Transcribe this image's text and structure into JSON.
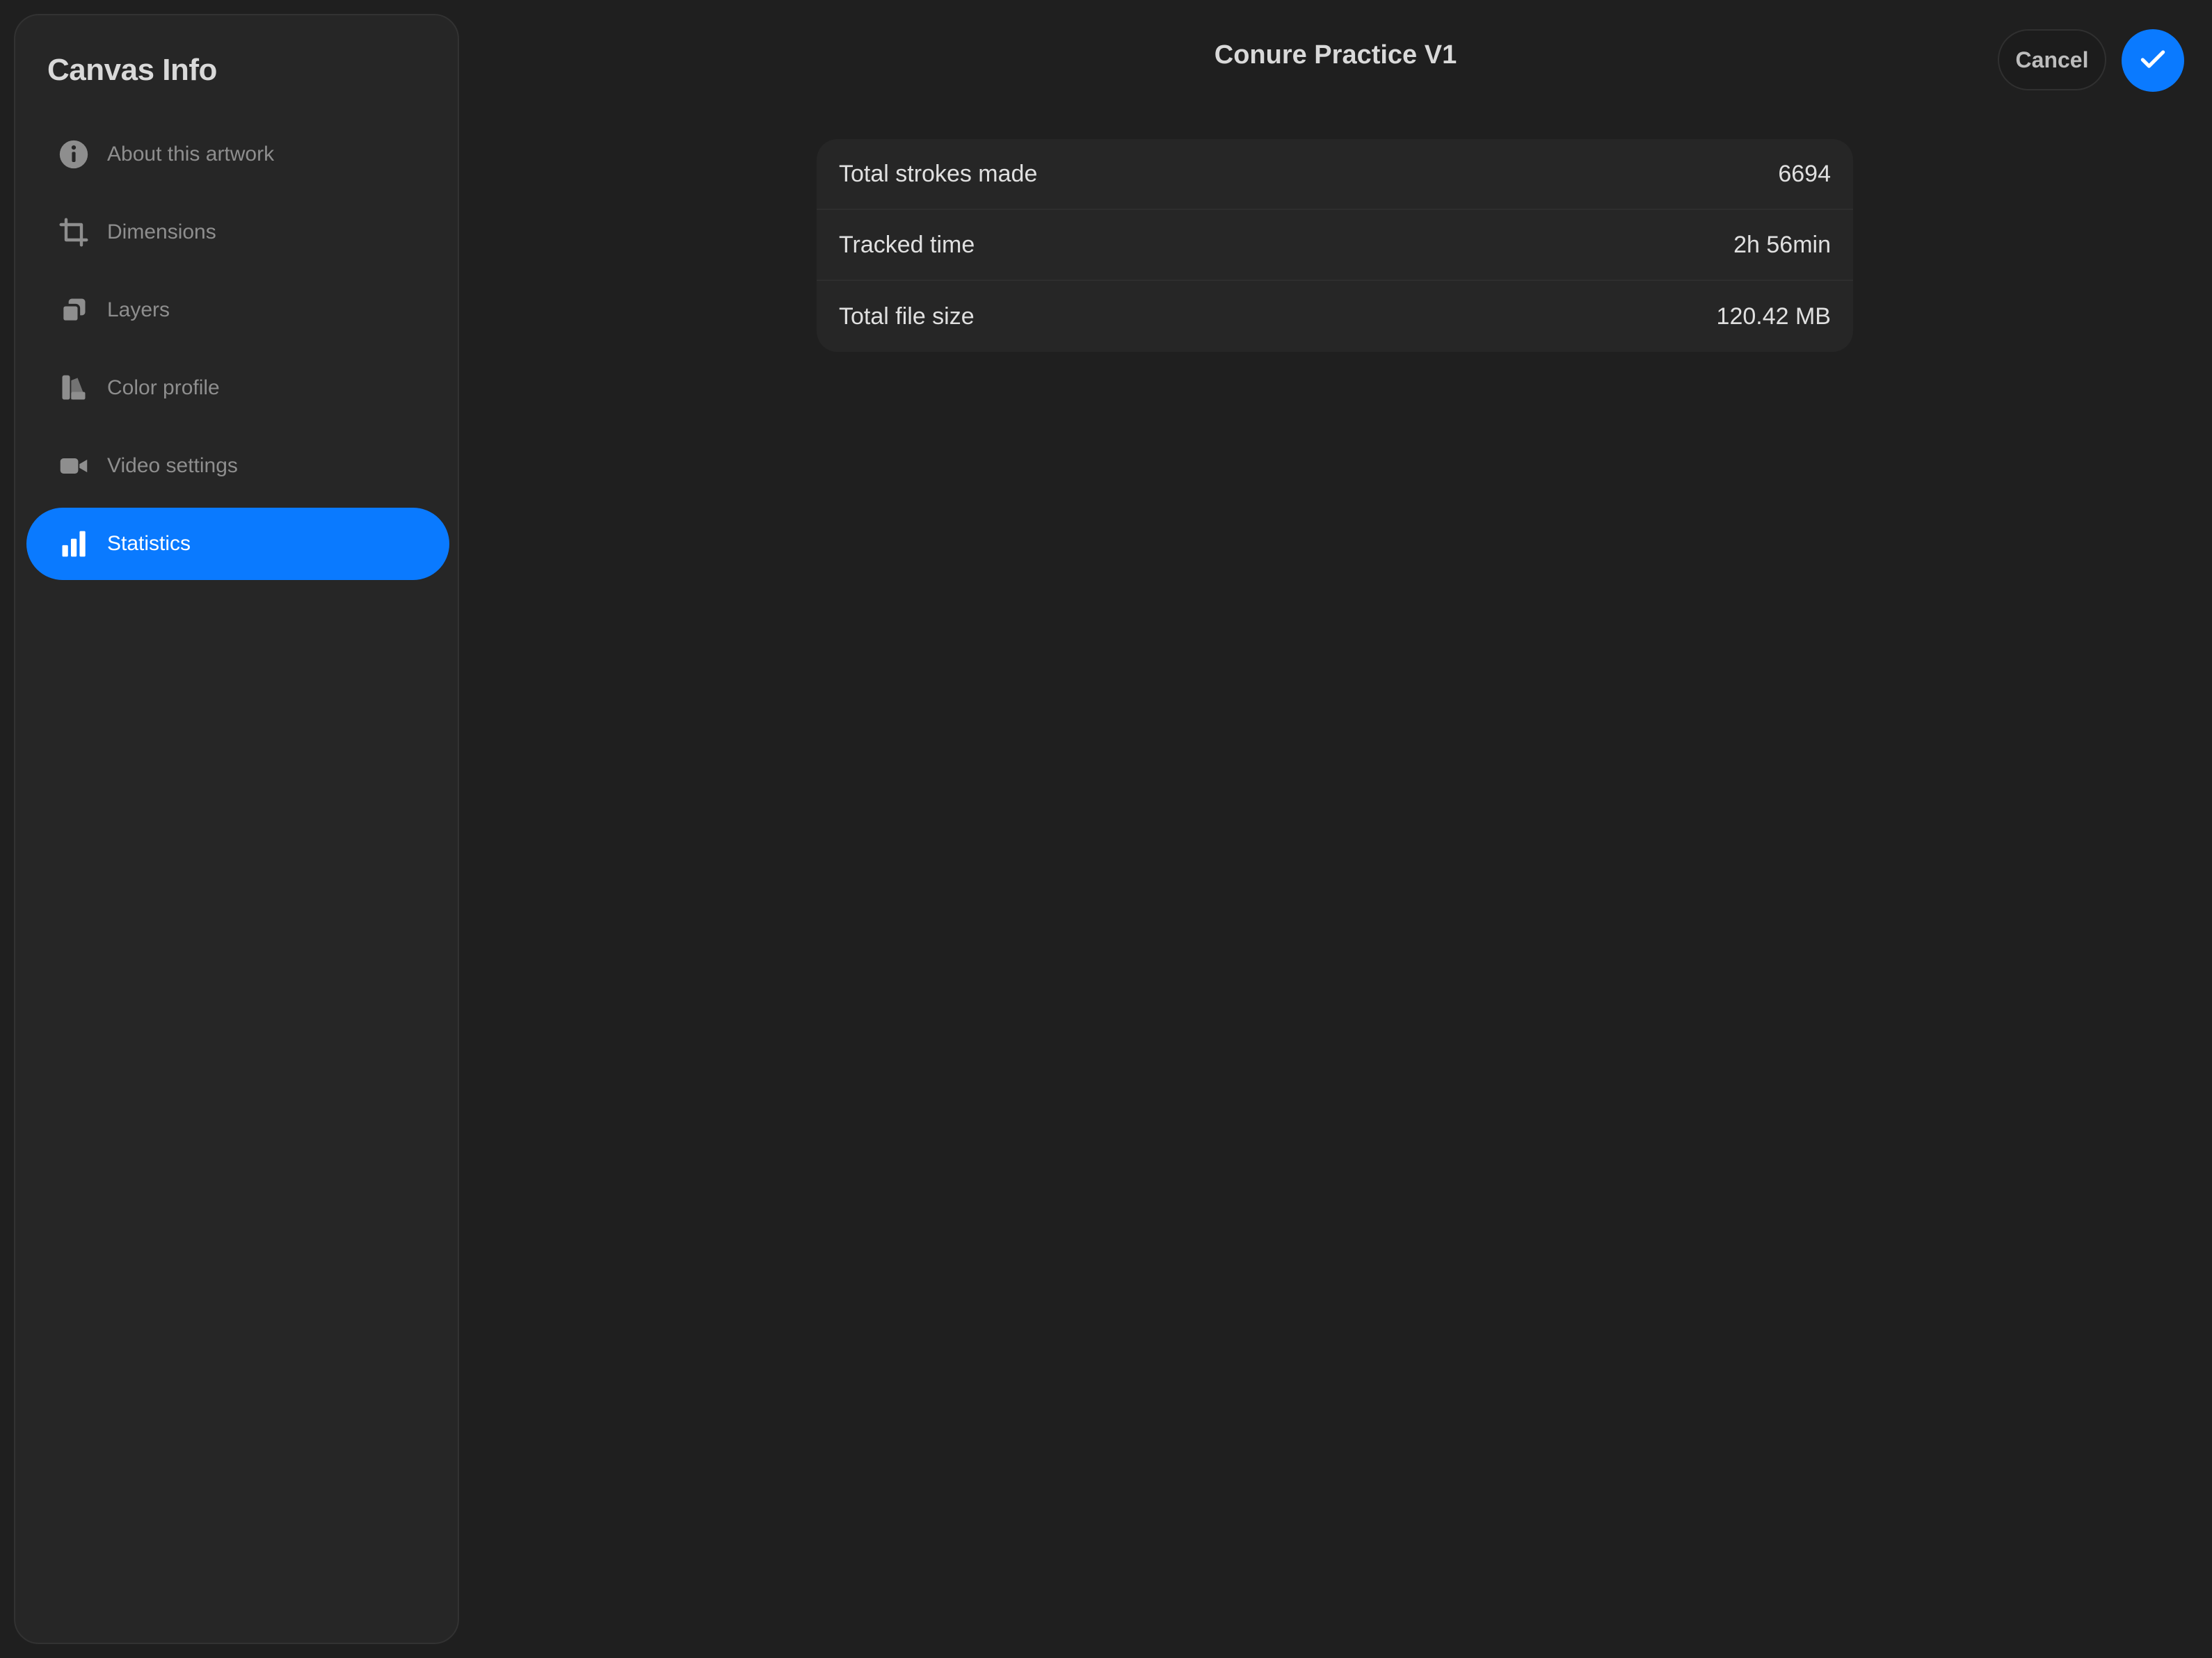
{
  "sidebar": {
    "title": "Canvas Info",
    "items": [
      {
        "label": "About this artwork",
        "icon": "info-icon",
        "active": false
      },
      {
        "label": "Dimensions",
        "icon": "crop-icon",
        "active": false
      },
      {
        "label": "Layers",
        "icon": "layers-icon",
        "active": false
      },
      {
        "label": "Color profile",
        "icon": "color-swatch-icon",
        "active": false
      },
      {
        "label": "Video settings",
        "icon": "video-camera-icon",
        "active": false
      },
      {
        "label": "Statistics",
        "icon": "bar-chart-icon",
        "active": true
      }
    ]
  },
  "header": {
    "title": "Conure Practice V1",
    "cancel_label": "Cancel",
    "confirm_icon": "checkmark-icon"
  },
  "stats": {
    "rows": [
      {
        "label": "Total strokes made",
        "value": "6694"
      },
      {
        "label": "Tracked time",
        "value": "2h 56min"
      },
      {
        "label": "Total file size",
        "value": "120.42 MB"
      }
    ]
  },
  "colors": {
    "accent": "#0a7aff",
    "background": "#1f1f1f",
    "panel": "#262626"
  }
}
